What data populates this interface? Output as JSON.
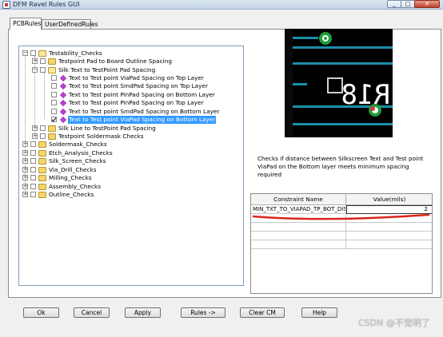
{
  "window": {
    "title": "DFM Ravel Rules GUI"
  },
  "tabs": [
    {
      "label": "PCBRules"
    },
    {
      "label": "UserDefinedRules"
    }
  ],
  "tree": {
    "nodes": [
      {
        "label": "Testability_Checks"
      },
      {
        "label": "Testpoint Pad to Board Outline Spacing"
      },
      {
        "label": "Silk Text to TestPoint Pad Spacing"
      },
      {
        "label": "Text to Test point ViaPad Spacing on Top Layer"
      },
      {
        "label": "Text to Test point SmdPad Spacing on Top Layer"
      },
      {
        "label": "Text to Test point PinPad Spacing on Bottom Layer"
      },
      {
        "label": "Text to Test point PinPad Spacing on Top Layer"
      },
      {
        "label": "Text to Test point SmdPad Spacing on Bottom Layer"
      },
      {
        "label": "Text to Test point ViaPad Spacing on Bottom Layer"
      },
      {
        "label": "Silk Line to TestPoint Pad Spacing"
      },
      {
        "label": "Testpoint Soldermask Checks"
      },
      {
        "label": "Soldermask_Checks"
      },
      {
        "label": "Etch_Analysis_Checks"
      },
      {
        "label": "Silk_Screen_Checks"
      },
      {
        "label": "Via_Drill_Checks"
      },
      {
        "label": "Milling_Checks"
      },
      {
        "label": "Assembly_Checks"
      },
      {
        "label": "Outline_Checks"
      }
    ]
  },
  "preview": {
    "glyph_text": "R18"
  },
  "description": "Checks if distance between Silkscreen Text and Test point ViaPad on the Bottom layer meets minimum spacing required",
  "grid": {
    "headers": [
      "Constraint Name",
      "Value(mils)"
    ],
    "rows": [
      {
        "name": "MIN_TXT_TO_VIAPAD_TP_BOT_DIS",
        "value": "2"
      }
    ]
  },
  "buttons": {
    "ok": "Ok",
    "cancel": "Cancel",
    "apply": "Apply",
    "rules": "Rules ->",
    "clear": "Clear CM",
    "help": "Help"
  },
  "watermark": "CSDN @不觉明了",
  "colors": {
    "selection": "#3399ff",
    "checker_diamond": "#b43fc9",
    "annotation_red": "#d9261c"
  }
}
